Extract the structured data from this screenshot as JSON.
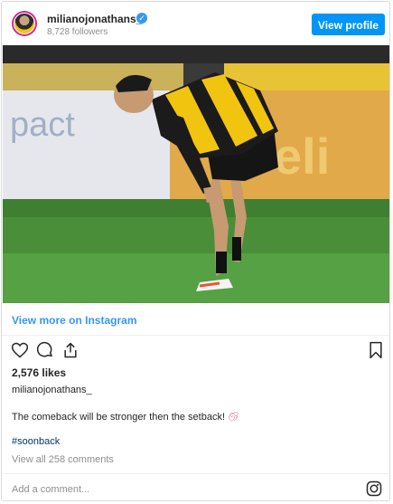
{
  "header": {
    "username": "milianojonathans_",
    "followers": "8,728 followers",
    "view_profile_label": "View profile"
  },
  "post": {
    "view_more_label": "View more on Instagram",
    "likes": "2,576 likes",
    "caption_username": "milianojonathans_",
    "caption_text": "The comeback will be stronger then the setback!",
    "hashtag": "#soonback",
    "comments_link": "View all 258 comments",
    "comment_placeholder": "Add a comment..."
  },
  "icons": [
    "heart-icon",
    "comment-icon",
    "share-icon",
    "bookmark-icon",
    "instagram-icon",
    "verified-badge-icon"
  ],
  "colors": {
    "accent": "#0095f6",
    "link": "#3897f0",
    "jersey_yellow": "#f1c40f"
  }
}
